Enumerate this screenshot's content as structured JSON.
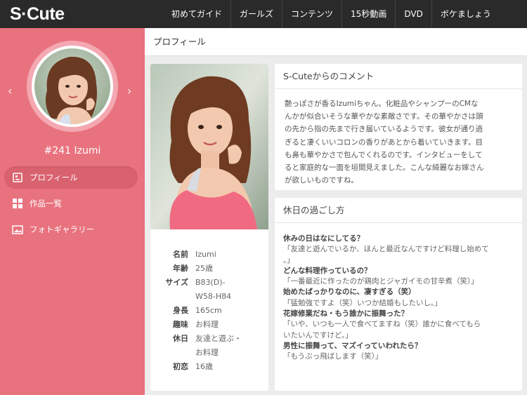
{
  "app": {
    "logo": "S·Cute"
  },
  "nav": [
    {
      "label": "初めてガイド"
    },
    {
      "label": "ガールズ"
    },
    {
      "label": "コンテンツ"
    },
    {
      "label": "15秒動画"
    },
    {
      "label": "DVD"
    },
    {
      "label": "ボケましょう"
    }
  ],
  "sidebar": {
    "prev_arrow": "‹",
    "next_arrow": "›",
    "name": "#241 Izumi",
    "menu": [
      {
        "label": "プロフィール",
        "icon": "profile-icon",
        "active": true
      },
      {
        "label": "作品一覧",
        "icon": "grid-icon",
        "active": false
      },
      {
        "label": "フォトギャラリー",
        "icon": "gallery-icon",
        "active": false
      }
    ]
  },
  "header": {
    "title": "プロフィール"
  },
  "profile": {
    "stats": [
      {
        "label": "名前",
        "value": "Izumi"
      },
      {
        "label": "年齢",
        "value": "25歳"
      },
      {
        "label": "サイズ",
        "value": "B83(D)-"
      },
      {
        "label": "",
        "value": "W58-H84"
      },
      {
        "label": "身長",
        "value": "165cm"
      },
      {
        "label": "趣味",
        "value": "お料理"
      },
      {
        "label": "休日",
        "value": "友達と遊ぶ・"
      },
      {
        "label": "",
        "value": "お料理"
      },
      {
        "label": "初恋",
        "value": "16歳"
      }
    ]
  },
  "comment": {
    "title": "S-Cuteからのコメント",
    "lines": [
      "艶っぽさが香るIzumiちゃん。化粧品やシャンプーのCMな",
      "んかが似合いそうな華やかな素敵さです。その華やかさは頭",
      "の先から指の先まで行き届いているようです。彼女が通り過",
      "ぎると凄くいいコロンの香りがあとから着いていきます。目",
      "も鼻も華やかさで包んでくれるのです。インタビューをして",
      "ると家庭的な一面を垣間見えました。こんな綺麗なお嫁さん",
      "が欲しいものですね。"
    ]
  },
  "holiday": {
    "title": "休日の過ごし方",
    "lines": [
      {
        "type": "q",
        "text": "休みの日はなにしてる？"
      },
      {
        "type": "a",
        "text": "「友達と遊んでいるか、ほんと最近なんですけど料理し始めて"
      },
      {
        "type": "a",
        "text": "。」"
      },
      {
        "type": "q",
        "text": "どんな料理作っているの？"
      },
      {
        "type": "a",
        "text": "「一番最近に作ったのが鶏肉とジャガイモの甘辛煮（笑）」"
      },
      {
        "type": "q",
        "text": "始めたばっかりなのに、凄すぎる（笑）"
      },
      {
        "type": "a",
        "text": "「猛勉強ですよ（笑）いつか結婚もしたいし。」"
      },
      {
        "type": "q",
        "text": "花嫁修業だね・もう誰かに振舞った？"
      },
      {
        "type": "a",
        "text": "「いや、いつも一人で食べてますね（笑）誰かに食べてもら"
      },
      {
        "type": "a",
        "text": "いたいんですけど。」"
      },
      {
        "type": "q",
        "text": "男性に振舞って、マズイっていわれたら？"
      },
      {
        "type": "a",
        "text": "「もうぶっ飛ばします（笑）」"
      }
    ]
  },
  "colors": {
    "sidebar_bg": "#e9727f",
    "topbar_bg": "#2a2a2a",
    "accent_shirt": "#f06a82"
  }
}
